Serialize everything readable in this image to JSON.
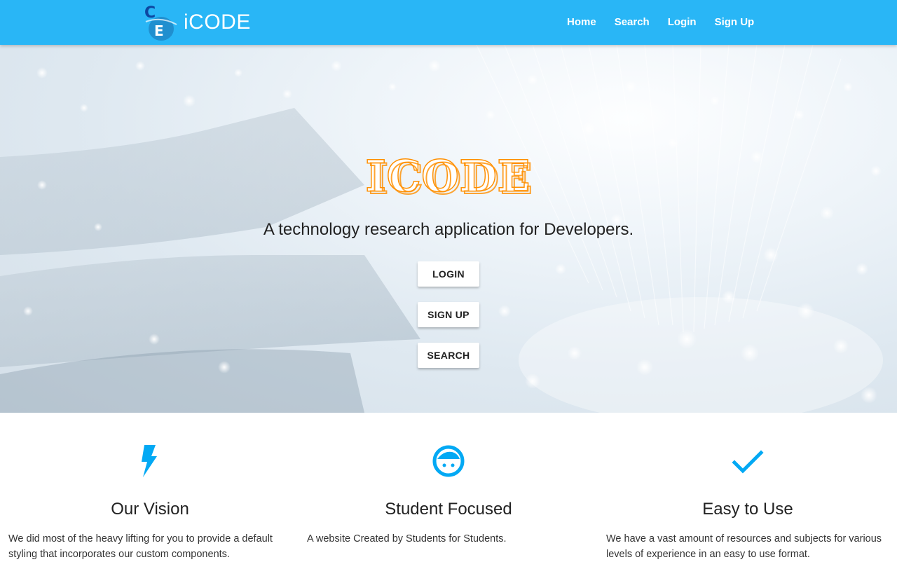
{
  "nav": {
    "brand": "iCODE",
    "links": [
      "Home",
      "Search",
      "Login",
      "Sign Up"
    ]
  },
  "hero": {
    "title": "ICODE",
    "subtitle": "A technology research application for Developers.",
    "buttons": [
      "LOGIN",
      "SIGN UP",
      "SEARCH"
    ]
  },
  "features": [
    {
      "icon": "bolt-icon",
      "title": "Our Vision",
      "text": "We did most of the heavy lifting for you to provide a default styling that incorporates our custom components."
    },
    {
      "icon": "face-icon",
      "title": "Student Focused",
      "text": "A website Created by Students for Students."
    },
    {
      "icon": "check-icon",
      "title": "Easy to Use",
      "text": "We have a vast amount of resources and subjects for various levels of experience in an easy to use format."
    }
  ],
  "colors": {
    "nav": "#29b6f6",
    "accent": "#03a9f4",
    "title_orange": "#ff8f00"
  }
}
